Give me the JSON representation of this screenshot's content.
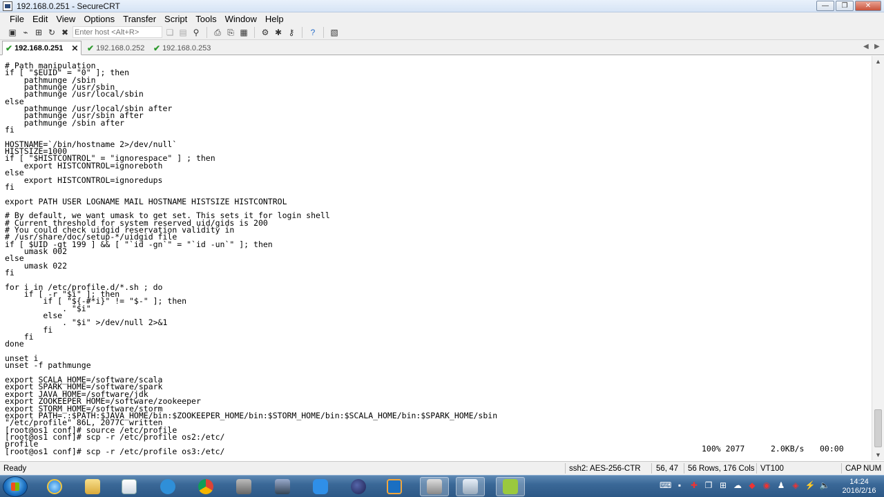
{
  "window": {
    "title": "192.168.0.251 - SecureCRT",
    "controls": {
      "minimize": "—",
      "maximize": "❐",
      "close": "✕"
    }
  },
  "menu": [
    "File",
    "Edit",
    "View",
    "Options",
    "Transfer",
    "Script",
    "Tools",
    "Window",
    "Help"
  ],
  "toolbar": {
    "host_placeholder": "Enter host <Alt+R>"
  },
  "tabs": [
    {
      "label": "192.168.0.251",
      "active": true,
      "close": "✕"
    },
    {
      "label": "192.168.0.252",
      "active": false
    },
    {
      "label": "192.168.0.253",
      "active": false
    }
  ],
  "terminal": {
    "lines": [
      "# Path manipulation",
      "if [ \"$EUID\" = \"0\" ]; then",
      "    pathmunge /sbin",
      "    pathmunge /usr/sbin",
      "    pathmunge /usr/local/sbin",
      "else",
      "    pathmunge /usr/local/sbin after",
      "    pathmunge /usr/sbin after",
      "    pathmunge /sbin after",
      "fi",
      "",
      "HOSTNAME=`/bin/hostname 2>/dev/null`",
      "HISTSIZE=1000",
      "if [ \"$HISTCONTROL\" = \"ignorespace\" ] ; then",
      "    export HISTCONTROL=ignoreboth",
      "else",
      "    export HISTCONTROL=ignoredups",
      "fi",
      "",
      "export PATH USER LOGNAME MAIL HOSTNAME HISTSIZE HISTCONTROL",
      "",
      "# By default, we want umask to get set. This sets it for login shell",
      "# Current threshold for system reserved uid/gids is 200",
      "# You could check uidgid reservation validity in",
      "# /usr/share/doc/setup-*/uidgid file",
      "if [ $UID -gt 199 ] && [ \"`id -gn`\" = \"`id -un`\" ]; then",
      "    umask 002",
      "else",
      "    umask 022",
      "fi",
      "",
      "for i in /etc/profile.d/*.sh ; do",
      "    if [ -r \"$i\" ]; then",
      "        if [ \"${-#*i}\" != \"$-\" ]; then",
      "            . \"$i\"",
      "        else",
      "            . \"$i\" >/dev/null 2>&1",
      "        fi",
      "    fi",
      "done",
      "",
      "unset i",
      "unset -f pathmunge",
      "",
      "export SCALA_HOME=/software/scala",
      "export SPARK_HOME=/software/spark",
      "export JAVA_HOME=/software/jdk",
      "export ZOOKEEPER_HOME=/software/zookeeper",
      "export STORM_HOME=/software/storm",
      "export PATH=.:$PATH:$JAVA_HOME/bin:$ZOOKEEPER_HOME/bin:$STORM_HOME/bin:$SCALA_HOME/bin:$SPARK_HOME/sbin",
      "\"/etc/profile\" 86L, 2077C written",
      "[root@os1 conf]# source /etc/profile",
      "[root@os1 conf]# scp -r /etc/profile os2:/etc/",
      "profile",
      "[root@os1 conf]# scp -r /etc/profile os3:/etc/"
    ],
    "transfer": {
      "percent_size": "100% 2077",
      "rate": "2.0KB/s",
      "time": "00:00"
    }
  },
  "status": {
    "ready": "Ready",
    "cipher": "ssh2: AES-256-CTR",
    "cursor": "56,  47",
    "dims": "56 Rows, 176 Cols",
    "emulation": "VT100",
    "caps": "CAP",
    "num": "NUM"
  },
  "taskbar": {
    "clock_time": "14:24",
    "clock_date": "2016/2/16"
  }
}
